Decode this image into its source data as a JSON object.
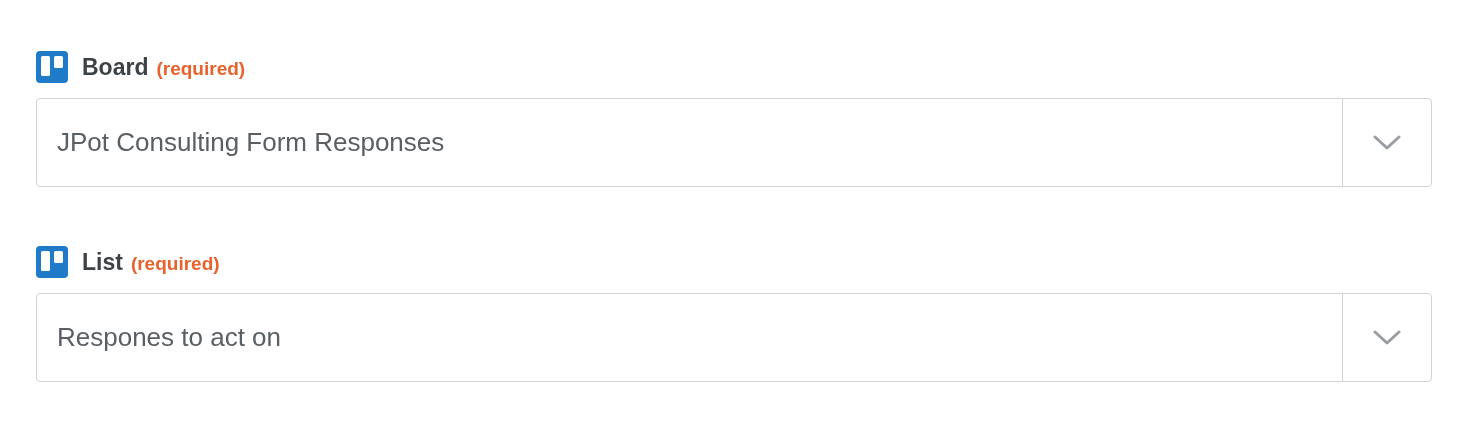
{
  "fields": [
    {
      "label": "Board",
      "required_note": "(required)",
      "value": "JPot Consulting Form Responses"
    },
    {
      "label": "List",
      "required_note": "(required)",
      "value": "Respones to act on"
    }
  ]
}
